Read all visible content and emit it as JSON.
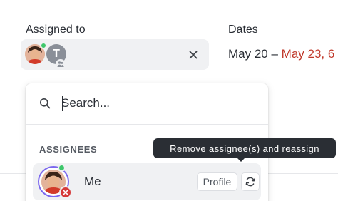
{
  "assigned": {
    "label": "Assigned to",
    "team_initial": "T",
    "icons": {
      "clear": "close-icon",
      "team": "people-icon"
    }
  },
  "dates": {
    "label": "Dates",
    "start": "May 20",
    "separator": " – ",
    "end": "May 23, 6"
  },
  "dropdown": {
    "search_placeholder": "Search...",
    "section_header": "ASSIGNEES",
    "assignee": {
      "name": "Me",
      "profile_label": "Profile",
      "reassign_icon": "refresh-icon",
      "remove_icon": "remove-icon"
    }
  },
  "tooltip": {
    "text": "Remove assignee(s) and reassign"
  },
  "colors": {
    "accent": "#7b68ee",
    "online": "#3ec76b",
    "danger": "#d63a3a",
    "due_date": "#c0392b",
    "tooltip_bg": "#2a2e34"
  }
}
